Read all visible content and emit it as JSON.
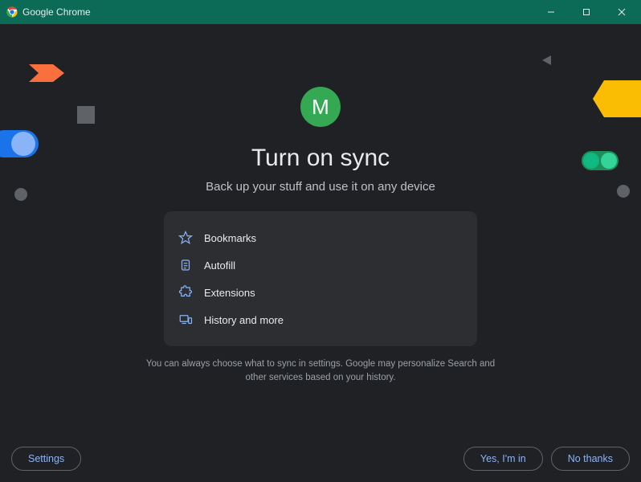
{
  "window": {
    "title": "Google Chrome"
  },
  "avatar": {
    "initial": "M"
  },
  "heading": "Turn on sync",
  "subheading": "Back up your stuff and use it on any device",
  "sync_items": [
    {
      "icon": "star",
      "label": "Bookmarks"
    },
    {
      "icon": "clipboard",
      "label": "Autofill"
    },
    {
      "icon": "puzzle",
      "label": "Extensions"
    },
    {
      "icon": "devices",
      "label": "History and more"
    }
  ],
  "disclaimer": "You can always choose what to sync in settings. Google may personalize Search and other services based on your history.",
  "footer": {
    "settings": "Settings",
    "confirm": "Yes, I'm in",
    "decline": "No thanks"
  }
}
